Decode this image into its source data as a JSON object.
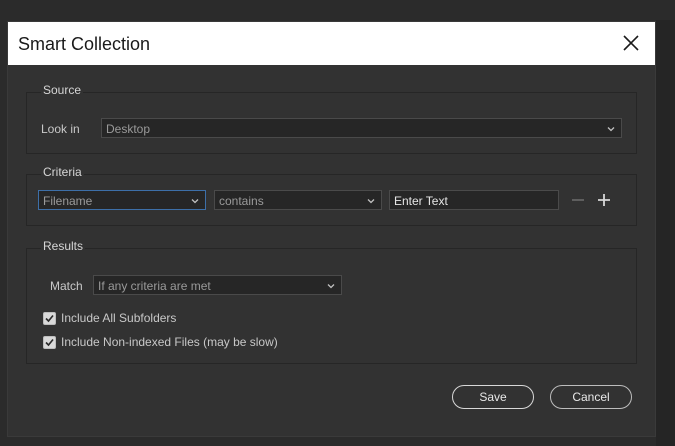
{
  "dialog": {
    "title": "Smart Collection"
  },
  "source": {
    "label": "Source",
    "look_in_label": "Look in",
    "look_in_value": "Desktop"
  },
  "criteria": {
    "label": "Criteria",
    "field": "Filename",
    "operator": "contains",
    "text_placeholder": "Enter Text"
  },
  "results": {
    "label": "Results",
    "match_label": "Match",
    "match_value": "If any criteria are met",
    "include_subfolders": "Include All Subfolders",
    "include_nonindexed": "Include Non-indexed Files (may be slow)"
  },
  "buttons": {
    "save": "Save",
    "cancel": "Cancel"
  },
  "colors": {
    "accent_focus": "#3d6fa8",
    "titlebar": "#ffffff",
    "dialog_bg": "#323232"
  }
}
